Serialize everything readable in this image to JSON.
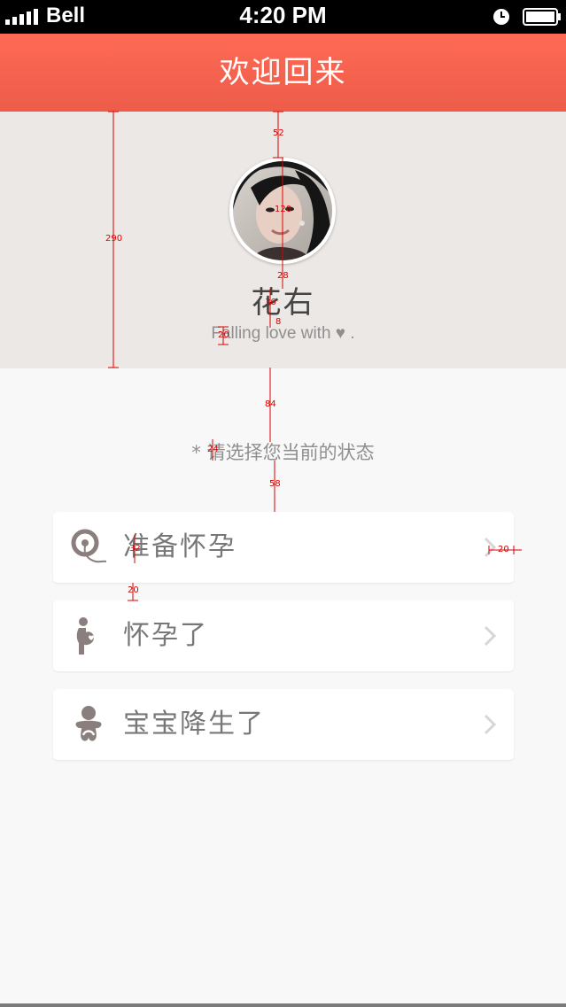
{
  "status_bar": {
    "carrier": "Bell",
    "time": "4:20 PM"
  },
  "header": {
    "title": "欢迎回来"
  },
  "profile": {
    "avatar_icon": "user-avatar-photo",
    "name": "花右",
    "tagline": "Falling love with ♥ ."
  },
  "prompt": "* 请选择您当前的状态",
  "options": [
    {
      "label": "准备怀孕",
      "icon": "sperm-egg-icon"
    },
    {
      "label": "怀孕了",
      "icon": "pregnant-woman-icon"
    },
    {
      "label": "宝宝降生了",
      "icon": "baby-icon"
    }
  ],
  "annotations": [
    "52",
    "120",
    "290",
    "28",
    "36",
    "8",
    "20",
    "84",
    "24",
    "58",
    "32",
    "20",
    "20"
  ],
  "colors": {
    "header_gradient_top": "#fe6a55",
    "header_gradient_bottom": "#ed5c4a",
    "profile_bg": "#ece8e5",
    "page_bg": "#f8f8f8",
    "icon_color": "#8a7f7c",
    "annotation_red": "#dd0000"
  }
}
